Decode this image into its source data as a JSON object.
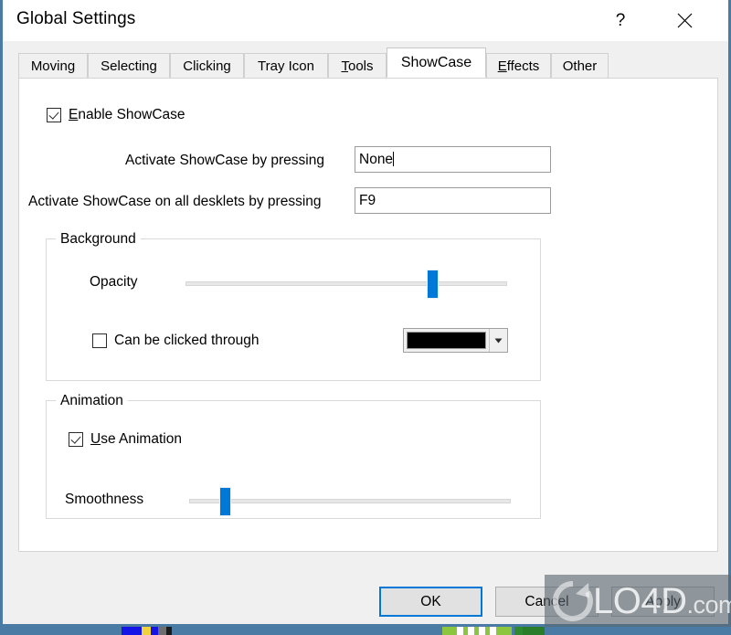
{
  "window": {
    "title": "Global Settings",
    "help_icon": "question-mark-icon",
    "close_icon": "close-icon",
    "border_color": "#4a7ba4"
  },
  "tabs": [
    {
      "label": "Moving",
      "accel": "",
      "active": false
    },
    {
      "label": "Selecting",
      "accel": "",
      "active": false
    },
    {
      "label": "Clicking",
      "accel": "",
      "active": false
    },
    {
      "label": "Tray Icon",
      "accel": "",
      "active": false
    },
    {
      "label": "Tools",
      "accel": "T",
      "active": false
    },
    {
      "label": "ShowCase",
      "accel": "",
      "active": true
    },
    {
      "label": "Effects",
      "accel": "E",
      "active": false
    },
    {
      "label": "Other",
      "accel": "",
      "active": false
    }
  ],
  "panel": {
    "enable_showcase": {
      "label": "Enable ShowCase",
      "accel": "E",
      "checked": true
    },
    "activate_key": {
      "label": "Activate ShowCase by pressing",
      "value": "None",
      "focused": true
    },
    "activate_all_key": {
      "label": "Activate ShowCase on all desklets by pressing",
      "value": "F9",
      "focused": false
    },
    "background_group": {
      "title": "Background",
      "opacity": {
        "label": "Opacity",
        "percent": 77
      },
      "click_through": {
        "label": "Can be clicked through",
        "checked": false
      },
      "color": {
        "value": "#000000",
        "arrow_icon": "chevron-down-icon"
      }
    },
    "animation_group": {
      "title": "Animation",
      "use_animation": {
        "label": "Use Animation",
        "accel": "U",
        "checked": true
      },
      "smoothness": {
        "label": "Smoothness",
        "percent": 11
      }
    }
  },
  "buttons": {
    "ok": "OK",
    "cancel": "Cancel",
    "apply": "Apply",
    "default_accent": "#0078d7"
  },
  "watermark": {
    "text": "LO4D",
    "suffix": ".com",
    "logo_icon": "refresh-circle-icon"
  }
}
